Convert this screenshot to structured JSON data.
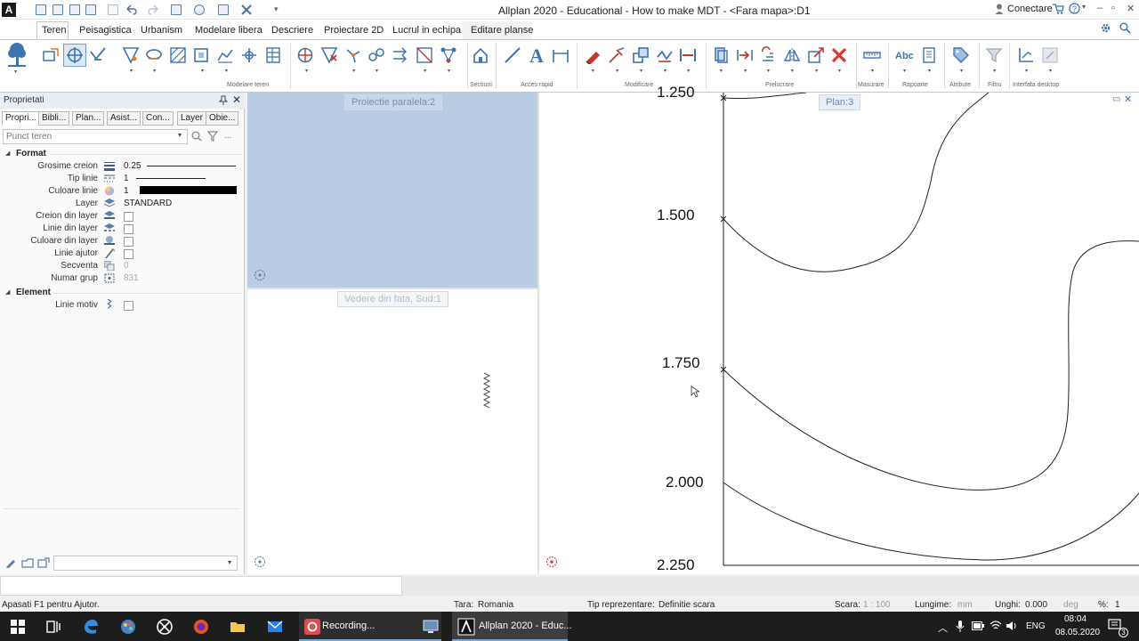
{
  "window": {
    "title": "Allplan 2020 - Educational - How to make MDT - <Fara mapa>:D1",
    "connect_label": "Conectare",
    "app_logo": "A"
  },
  "ribbon": {
    "tabs": [
      "Teren",
      "Peisagistica",
      "Urbanism",
      "Modelare libera",
      "Descriere",
      "Proiectare 2D",
      "Lucrul in echipa",
      "Editare planse"
    ],
    "active_tab": "Teren",
    "groups": [
      "Modelare teren",
      "Sectiuni",
      "Acces rapid",
      "Modificare",
      "Prelucrare",
      "Masurare",
      "Rapoarte",
      "Atribute",
      "Filtru",
      "Interfata desktop"
    ],
    "text_icons": [
      "Abc",
      "A"
    ]
  },
  "properties": {
    "title": "Proprietati",
    "tabs": [
      "Propri...",
      "Bibli...",
      "Plan...",
      "Asist...",
      "Con...",
      "Layer",
      "Obie..."
    ],
    "filter_placeholder": "Punct teren",
    "sections": [
      {
        "name": "Format",
        "rows": [
          {
            "label": "Grosime creion",
            "value": "0.25"
          },
          {
            "label": "Tip linie",
            "value": "1"
          },
          {
            "label": "Culoare linie",
            "value": "1"
          },
          {
            "label": "Layer",
            "value": "STANDARD"
          },
          {
            "label": "Creion din layer",
            "value": ""
          },
          {
            "label": "Linie din layer",
            "value": ""
          },
          {
            "label": "Culoare din layer",
            "value": ""
          },
          {
            "label": "Linie ajutor",
            "value": ""
          },
          {
            "label": "Secventa",
            "value": "0"
          },
          {
            "label": "Numar grup",
            "value": "831"
          }
        ]
      },
      {
        "name": "Element",
        "rows": [
          {
            "label": "Linie motiv",
            "value": ""
          }
        ]
      }
    ]
  },
  "viewports": {
    "top_left": "Proiectie paralela:2",
    "bottom_left": "Vedere din fata, Sud:1",
    "right": "Plan:3",
    "axis_labels": [
      "1.250",
      "1.500",
      "1.750",
      "2.000",
      "2.250"
    ]
  },
  "status": {
    "help": "Apasati F1 pentru Ajutor.",
    "tara_label": "Tara:",
    "tara_value": "Romania",
    "tip_label": "Tip reprezentare:",
    "tip_value": "Definitie scara",
    "scara_label": "Scara:",
    "scara_value": "1 : 100",
    "lungime_label": "Lungime:",
    "lungime_unit": "mm",
    "unghi_label": "Unghi:",
    "unghi_value": "0.000",
    "unghi_unit": "deg",
    "pct_label": "%:",
    "pct_value": "1"
  },
  "taskbar": {
    "recording_label": "Recording...",
    "allplan_label": "Allplan 2020 - Educ...",
    "lang": "ENG",
    "time": "08:04",
    "date": "08.05.2020",
    "notif_count": "3"
  }
}
